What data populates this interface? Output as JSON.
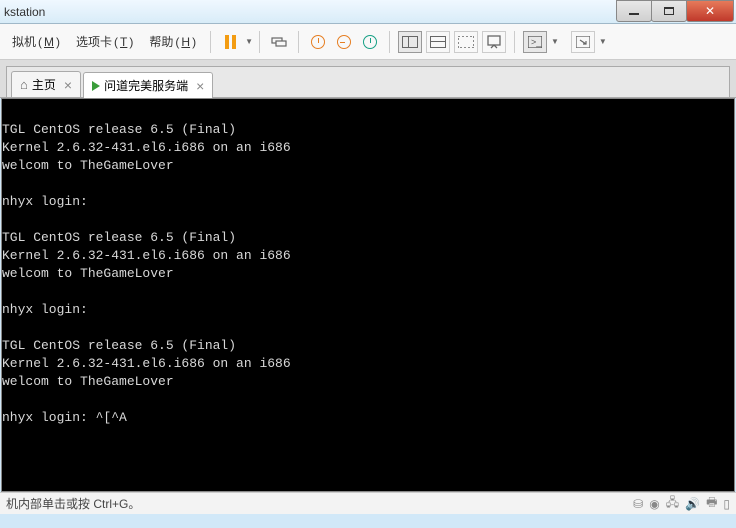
{
  "titlebar": {
    "text": "kstation"
  },
  "menubar": {
    "items": [
      {
        "label": "拟机",
        "key": "M"
      },
      {
        "label": "选项卡",
        "key": "T"
      },
      {
        "label": "帮助",
        "key": "H"
      }
    ]
  },
  "tabs": {
    "home": {
      "label": "主页"
    },
    "active": {
      "label": "问道完美服务端"
    }
  },
  "terminal": {
    "lines": [
      "",
      "TGL CentOS release 6.5 (Final)",
      "Kernel 2.6.32-431.el6.i686 on an i686",
      "welcom to TheGameLover",
      "",
      "nhyx login:",
      "",
      "TGL CentOS release 6.5 (Final)",
      "Kernel 2.6.32-431.el6.i686 on an i686",
      "welcom to TheGameLover",
      "",
      "nhyx login:",
      "",
      "TGL CentOS release 6.5 (Final)",
      "Kernel 2.6.32-431.el6.i686 on an i686",
      "welcom to TheGameLover",
      "",
      "nhyx login: ^[^A"
    ]
  },
  "statusbar": {
    "hint": "机内部单击或按 Ctrl+G。"
  }
}
